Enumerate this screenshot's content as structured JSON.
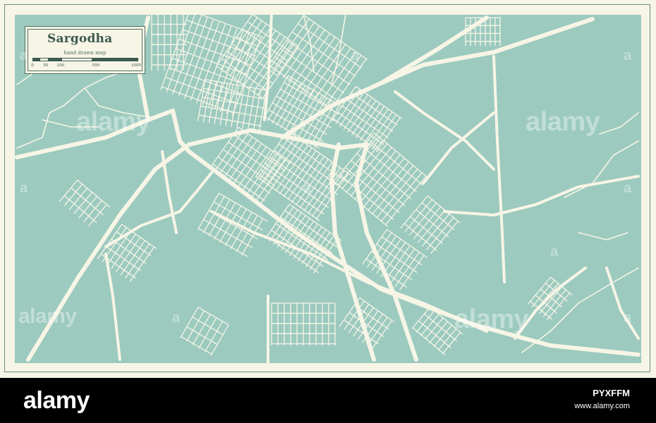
{
  "map": {
    "title": "Sargodha",
    "subtitle": "hand drawn map",
    "scale_labels": [
      "0",
      "50",
      "100",
      "500",
      "1000"
    ],
    "colors": {
      "land": "#9ccabf",
      "road": "#f7f5e6",
      "frame": "#f7f5e6",
      "ink": "#3c5a4f"
    }
  },
  "watermarks": [
    {
      "text": "alamy"
    },
    {
      "text": "alamy"
    },
    {
      "text": "alamy"
    },
    {
      "text": "alamy"
    },
    {
      "text": "a"
    },
    {
      "text": "a"
    },
    {
      "text": "a"
    },
    {
      "text": "a"
    },
    {
      "text": "a"
    },
    {
      "text": "a"
    },
    {
      "text": "a"
    },
    {
      "text": "a"
    },
    {
      "text": "a"
    }
  ],
  "footer": {
    "brand": "alamy",
    "image_id": "PYXFFM",
    "url": "www.alamy.com"
  }
}
